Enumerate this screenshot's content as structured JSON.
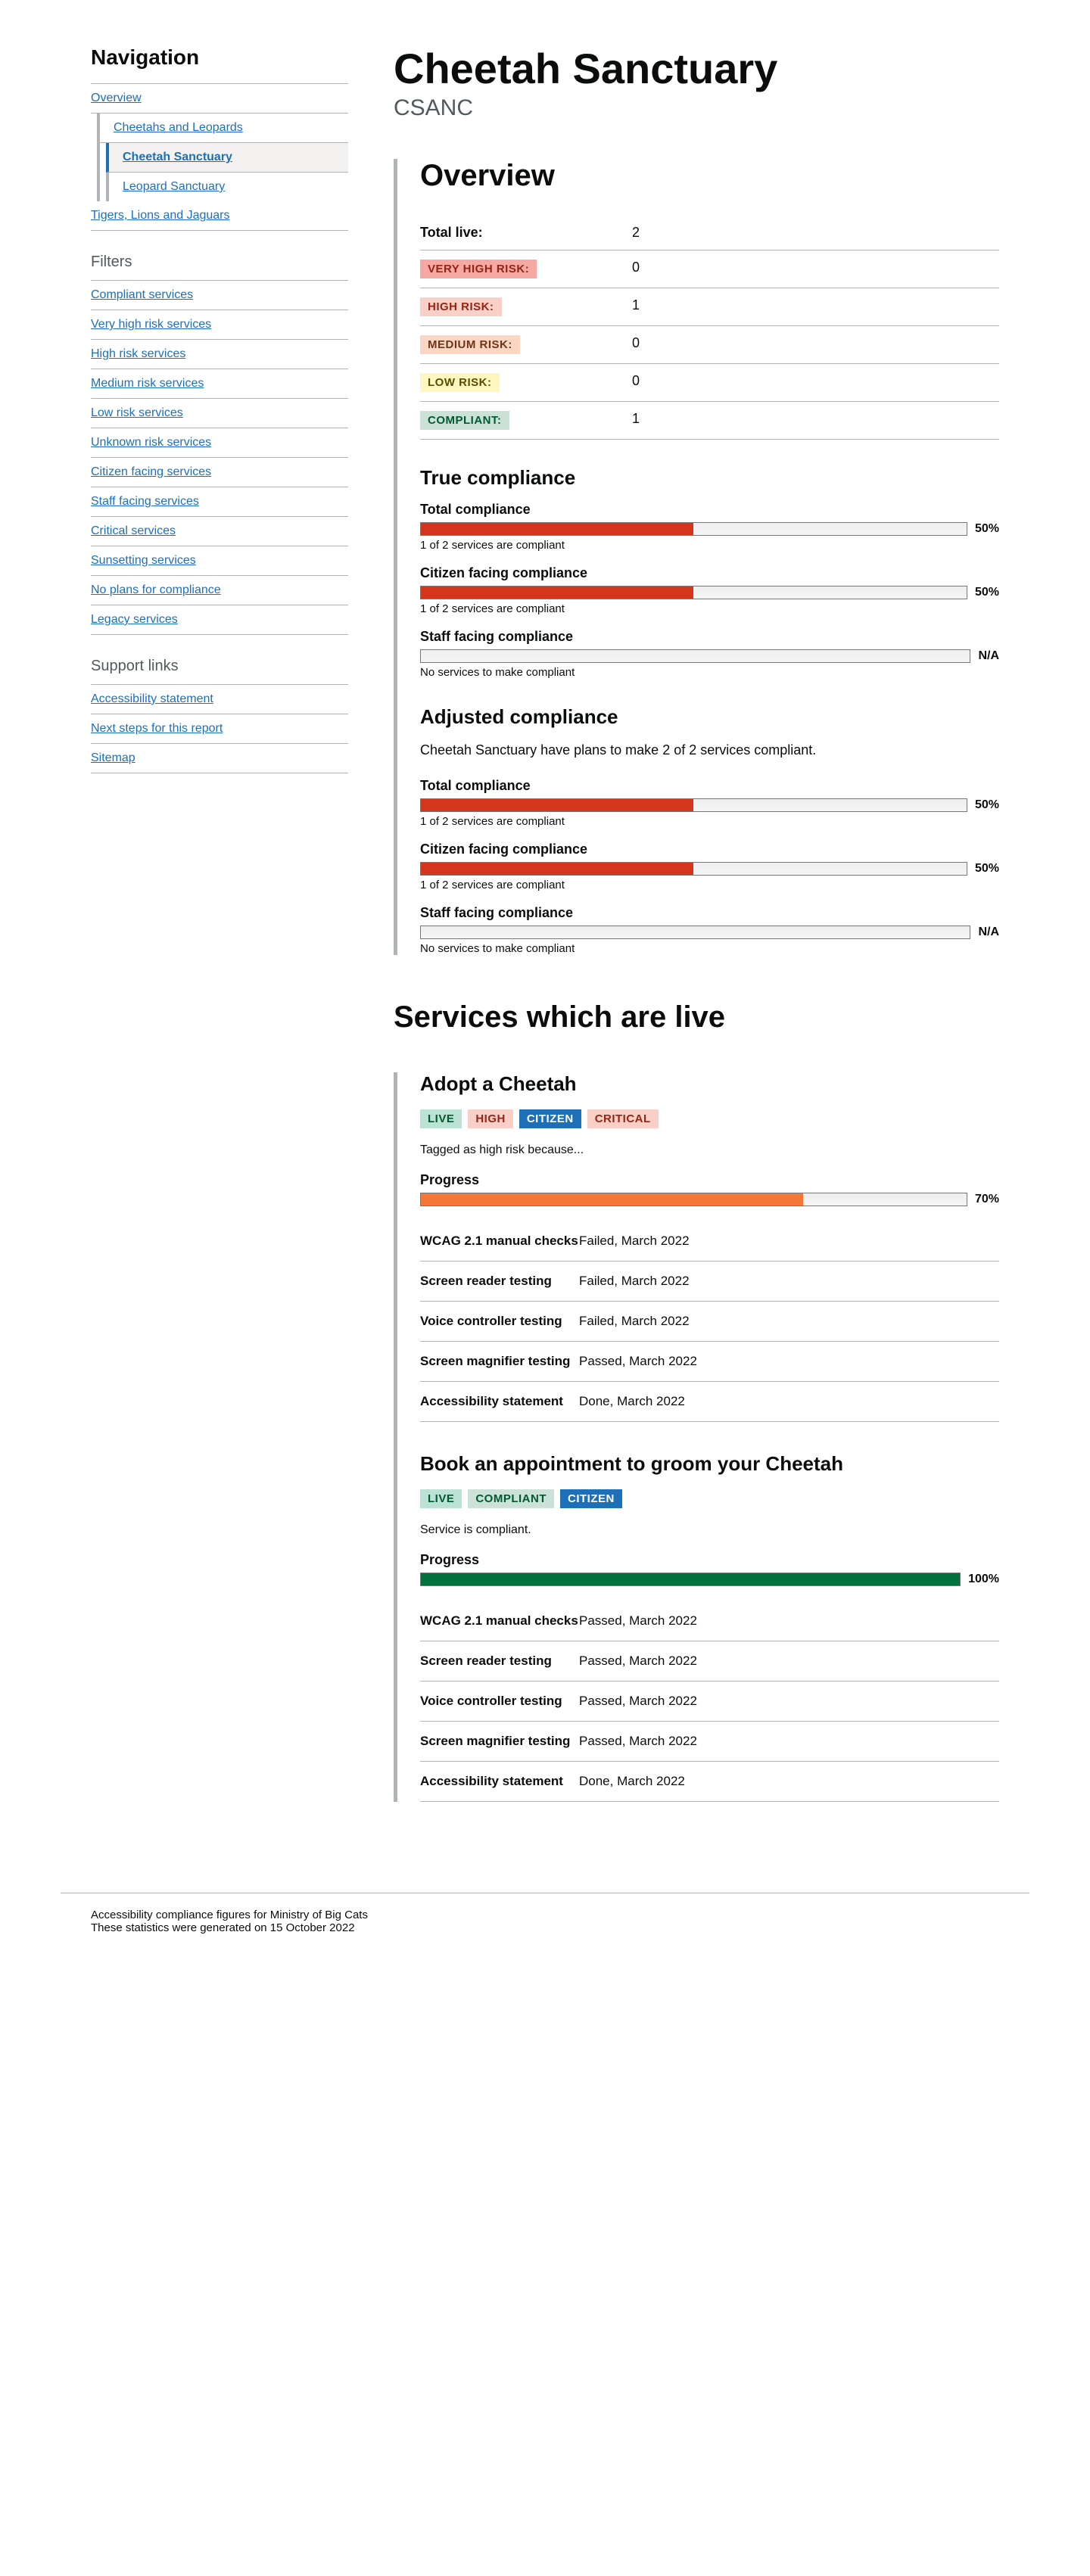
{
  "header": {
    "title": "Cheetah Sanctuary",
    "subtitle": "CSANC"
  },
  "nav": {
    "title": "Navigation",
    "overview": "Overview",
    "sub": [
      {
        "label": "Cheetahs and Leopards",
        "children": [
          {
            "label": "Cheetah Sanctuary",
            "active": true
          },
          {
            "label": "Leopard Sanctuary"
          }
        ]
      },
      {
        "label": "Tigers, Lions and Jaguars"
      }
    ],
    "filters_title": "Filters",
    "filters": [
      "Compliant services",
      "Very high risk services",
      "High risk services",
      "Medium risk services",
      "Low risk services",
      "Unknown risk services",
      "Citizen facing services",
      "Staff facing services",
      "Critical services",
      "Sunsetting services",
      "No plans for compliance",
      "Legacy services"
    ],
    "support_title": "Support links",
    "support": [
      "Accessibility statement",
      "Next steps for this report",
      "Sitemap"
    ]
  },
  "overview": {
    "heading": "Overview",
    "rows": [
      {
        "key_text": "Total live:",
        "value": "2",
        "tag": false
      },
      {
        "key_text": "Very high risk:",
        "value": "0",
        "tag": "vhrisk"
      },
      {
        "key_text": "High risk:",
        "value": "1",
        "tag": "hrisk"
      },
      {
        "key_text": "Medium risk:",
        "value": "0",
        "tag": "mrisk"
      },
      {
        "key_text": "Low risk:",
        "value": "0",
        "tag": "lrisk"
      },
      {
        "key_text": "Compliant:",
        "value": "1",
        "tag": "compliant"
      }
    ],
    "true_heading": "True compliance",
    "true_blocks": [
      {
        "title": "Total compliance",
        "pct": 50,
        "label": "50%",
        "caption": "1 of 2 services are compliant",
        "color": "red"
      },
      {
        "title": "Citizen facing compliance",
        "pct": 50,
        "label": "50%",
        "caption": "1 of 2 services are compliant",
        "color": "red"
      },
      {
        "title": "Staff facing compliance",
        "pct": 0,
        "label": "N/A",
        "caption": "No services to make compliant",
        "color": "none"
      }
    ],
    "adj_heading": "Adjusted compliance",
    "adj_desc": "Cheetah Sanctuary have plans to make 2 of 2 services compliant.",
    "adj_blocks": [
      {
        "title": "Total compliance",
        "pct": 50,
        "label": "50%",
        "caption": "1 of 2 services are compliant",
        "color": "red"
      },
      {
        "title": "Citizen facing compliance",
        "pct": 50,
        "label": "50%",
        "caption": "1 of 2 services are compliant",
        "color": "red"
      },
      {
        "title": "Staff facing compliance",
        "pct": 0,
        "label": "N/A",
        "caption": "No services to make compliant",
        "color": "none"
      }
    ]
  },
  "services": {
    "heading": "Services which are live",
    "list": [
      {
        "title": "Adopt a Cheetah",
        "tags": [
          {
            "label": "Live",
            "cls": "live"
          },
          {
            "label": "High",
            "cls": "high"
          },
          {
            "label": "Citizen",
            "cls": "citizen"
          },
          {
            "label": "Critical",
            "cls": "critical"
          }
        ],
        "note": "Tagged as high risk because...",
        "progress_title": "Progress",
        "progress_pct": 70,
        "progress_label": "70%",
        "progress_color": "orange",
        "checks": [
          {
            "key": "WCAG 2.1 manual checks",
            "val": "Failed, March 2022"
          },
          {
            "key": "Screen reader testing",
            "val": "Failed, March 2022"
          },
          {
            "key": "Voice controller testing",
            "val": "Failed, March 2022"
          },
          {
            "key": "Screen magnifier testing",
            "val": "Passed, March 2022"
          },
          {
            "key": "Accessibility statement",
            "val": "Done, March 2022"
          }
        ]
      },
      {
        "title": "Book an appointment to groom your Cheetah",
        "tags": [
          {
            "label": "Live",
            "cls": "live"
          },
          {
            "label": "Compliant",
            "cls": "compliant2"
          },
          {
            "label": "Citizen",
            "cls": "citizen"
          }
        ],
        "note": "Service is compliant.",
        "progress_title": "Progress",
        "progress_pct": 100,
        "progress_label": "100%",
        "progress_color": "green",
        "checks": [
          {
            "key": "WCAG 2.1 manual checks",
            "val": "Passed, March 2022"
          },
          {
            "key": "Screen reader testing",
            "val": "Passed, March 2022"
          },
          {
            "key": "Voice controller testing",
            "val": "Passed, March 2022"
          },
          {
            "key": "Screen magnifier testing",
            "val": "Passed, March 2022"
          },
          {
            "key": "Accessibility statement",
            "val": "Done, March 2022"
          }
        ]
      }
    ]
  },
  "footer": {
    "line1": "Accessibility compliance figures for Ministry of Big Cats",
    "line2": "These statistics were generated on 15 October 2022"
  }
}
